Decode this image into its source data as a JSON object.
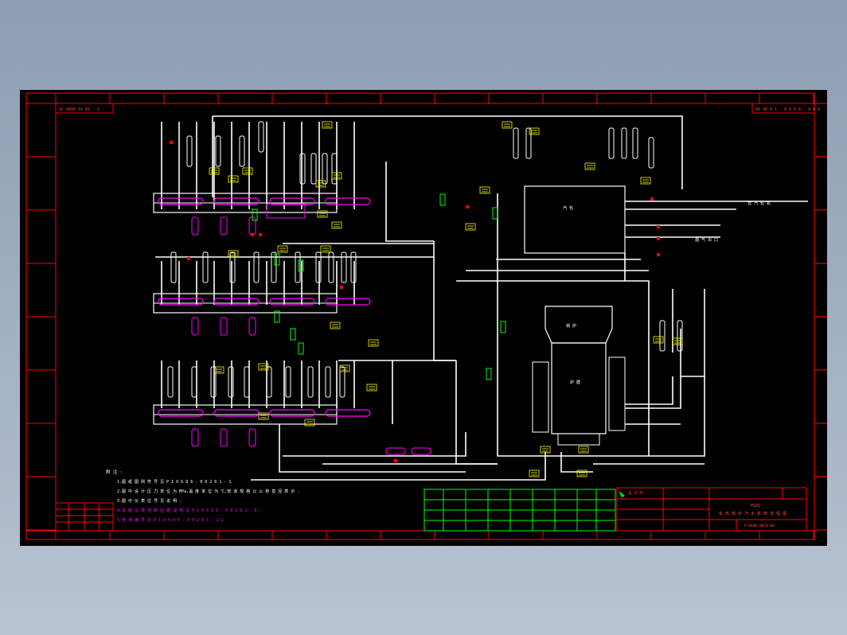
{
  "drawing": {
    "top_left_code": "GC-0600 01 01 - 1",
    "top_right_code": "00 00 0 1 - 0 6 0 6 - 0 0 0",
    "colors": {
      "background": "#000000",
      "frame": "#ff0000",
      "pipe": "#ffffff",
      "tag": "#ffff00",
      "equipment": "#ff00ff",
      "valve": "#00ff00"
    },
    "notes": {
      "heading": "附 注 :",
      "lines": [
        "1.图 纸 图 例 符 号 见 P I 0 6 0 6 - 0 0 2 0 1 - 1",
        "2.图 中 设 计 压 力 单 位 为 MPa,温 度 单 位 为 ℃,管 道 规 格 以 公 称 直 径 表 示 .",
        "3.图 中 仪 表 位 号 见 说 明 .",
        "4.本 图 仪 表 控 制 回 路 说 明 见 P I 0 6 0 6 - 0 0 2 0 1 - 0 .",
        "5.管 道 编 号 见 P I 0 6 0 6 - 0 0 2 0 1 - 1 1 ."
      ]
    },
    "title_block": {
      "company": "设 计 院",
      "project": "P&ID",
      "title": "余 热 锅 炉 汽 水 系 统 流 程 图",
      "drawing_no": "P-0606-0020-00"
    },
    "equipment_labels": {
      "drum": "汽 包",
      "furnace": "锅 炉",
      "furnace_inner": "炉 膛",
      "steam_out": "去 汽 轮 机",
      "flue": "烟 气 出 口"
    }
  }
}
